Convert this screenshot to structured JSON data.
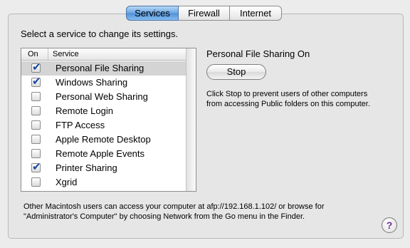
{
  "tabs": [
    {
      "label": "Services",
      "active": true
    },
    {
      "label": "Firewall",
      "active": false
    },
    {
      "label": "Internet",
      "active": false
    }
  ],
  "prompt": "Select a service to change its settings.",
  "list": {
    "col_on": "On",
    "col_service": "Service",
    "rows": [
      {
        "label": "Personal File Sharing",
        "checked": true,
        "selected": true
      },
      {
        "label": "Windows Sharing",
        "checked": true,
        "selected": false
      },
      {
        "label": "Personal Web Sharing",
        "checked": false,
        "selected": false
      },
      {
        "label": "Remote Login",
        "checked": false,
        "selected": false
      },
      {
        "label": "FTP Access",
        "checked": false,
        "selected": false
      },
      {
        "label": "Apple Remote Desktop",
        "checked": false,
        "selected": false
      },
      {
        "label": "Remote Apple Events",
        "checked": false,
        "selected": false
      },
      {
        "label": "Printer Sharing",
        "checked": true,
        "selected": false
      },
      {
        "label": "Xgrid",
        "checked": false,
        "selected": false
      }
    ]
  },
  "detail": {
    "status": "Personal File Sharing On",
    "button_label": "Stop",
    "description": "Click Stop to prevent users of other computers from accessing Public folders on this computer."
  },
  "footnote": "Other Macintosh users can access your computer at afp://192.168.1.102/ or browse for \"Administrator's Computer\" by choosing Network from the Go menu in the Finder.",
  "help_glyph": "?",
  "icons": {
    "help": "help-icon",
    "check": "checkmark-icon"
  },
  "colors": {
    "tab_active": "#6aa5e3",
    "checkmark": "#18459f",
    "help": "#6b2c8f"
  }
}
